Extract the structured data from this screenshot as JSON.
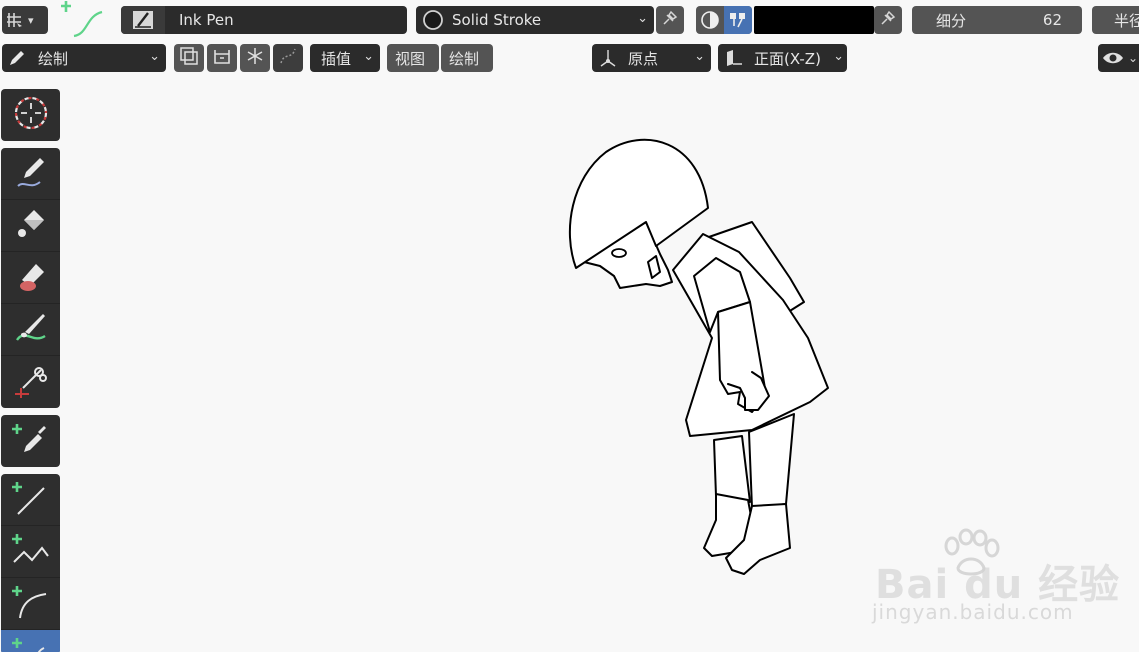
{
  "header": {
    "brush_name": "Ink Pen",
    "material_name": "Solid Stroke",
    "subdivide_label": "细分",
    "subdivide_value": "62",
    "radius_label_partial": "半径"
  },
  "toolbar": {
    "mode_label": "绘制",
    "interpolate_label": "插值",
    "view_label": "视图",
    "draw_label": "绘制",
    "origin_label": "原点",
    "plane_label": "正面(X-Z)"
  },
  "tools": [
    {
      "name": "cursor-tool",
      "icon": "cursor-icon",
      "active": false
    },
    {
      "name": "draw-tool",
      "icon": "pencil-icon",
      "active": false
    },
    {
      "name": "fill-tool",
      "icon": "fill-bucket-icon",
      "active": false
    },
    {
      "name": "erase-tool",
      "icon": "eraser-icon",
      "active": false
    },
    {
      "name": "tint-tool",
      "icon": "brush-icon",
      "active": false
    },
    {
      "name": "cutter-tool",
      "icon": "scissors-icon",
      "active": false
    },
    {
      "name": "eyedropper-tool",
      "icon": "eyedropper-icon",
      "active": false
    },
    {
      "name": "line-tool",
      "icon": "line-icon",
      "active": false
    },
    {
      "name": "polyline-tool",
      "icon": "polyline-icon",
      "active": false
    },
    {
      "name": "arc-tool",
      "icon": "arc-icon",
      "active": false
    },
    {
      "name": "curve-tool",
      "icon": "curve-icon",
      "active": true
    }
  ],
  "colors": {
    "active_blue": "#4772b3",
    "panel_dark": "#2b2b2b",
    "viewport_bg": "#f8f8f8",
    "stroke_color": "#000000"
  },
  "watermark": {
    "brand_text": "Bai du 经验",
    "url_text": "jingyan.baidu.com"
  }
}
